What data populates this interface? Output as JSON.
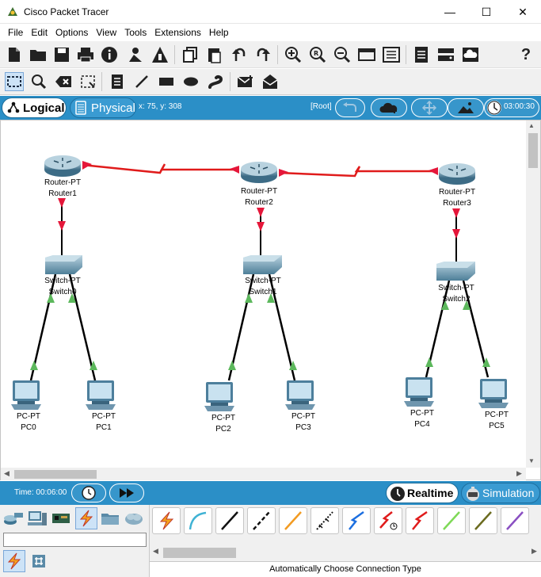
{
  "window": {
    "title": "Cisco Packet Tracer",
    "minimize": "—",
    "maximize": "☐",
    "close": "✕"
  },
  "menu": [
    {
      "label": "File"
    },
    {
      "label": "Edit"
    },
    {
      "label": "Options"
    },
    {
      "label": "View"
    },
    {
      "label": "Tools"
    },
    {
      "label": "Extensions"
    },
    {
      "label": "Help"
    }
  ],
  "toolbar_main": [
    "new-file-icon",
    "open-folder-icon",
    "save-icon",
    "print-icon",
    "info-icon",
    "activity-wizard-icon",
    "pdu-icon",
    "copy-icon",
    "paste-icon",
    "undo-icon",
    "redo-icon",
    "zoom-in-icon",
    "zoom-reset-icon",
    "zoom-out-icon",
    "palette-icon",
    "custom-device-icon",
    "notes-icon",
    "rack-icon",
    "cloud-icon",
    "help-icon"
  ],
  "mode": {
    "logical": "Logical",
    "physical": "Physical",
    "coords": "x: 75, y: 308",
    "root": "[Root]",
    "clock": "03:00:30"
  },
  "devices": {
    "routers": [
      {
        "type": "Router-PT",
        "name": "Router1"
      },
      {
        "type": "Router-PT",
        "name": "Router2"
      },
      {
        "type": "Router-PT",
        "name": "Router3"
      }
    ],
    "switches": [
      {
        "type": "Switch-PT",
        "name": "Switch0"
      },
      {
        "type": "Switch-PT",
        "name": "Switch1"
      },
      {
        "type": "Switch-PT",
        "name": "Switch2"
      }
    ],
    "pcs": [
      {
        "type": "PC-PT",
        "name": "PC0"
      },
      {
        "type": "PC-PT",
        "name": "PC1"
      },
      {
        "type": "PC-PT",
        "name": "PC2"
      },
      {
        "type": "PC-PT",
        "name": "PC3"
      },
      {
        "type": "PC-PT",
        "name": "PC4"
      },
      {
        "type": "PC-PT",
        "name": "PC5"
      }
    ]
  },
  "link_colors": {
    "serial": "#e01b1b",
    "ethernet": "#000000",
    "down_marker": "#e5173a",
    "up_marker": "#5cb85c"
  },
  "sim": {
    "time": "Time: 00:06:00",
    "realtime": "Realtime",
    "simulation": "Simulation"
  },
  "bottom": {
    "search_value": "",
    "status": "Automatically Choose Connection Type"
  },
  "connections": [
    "auto-connection-icon",
    "console-cable-icon",
    "copper-straight-icon",
    "copper-cross-icon",
    "fiber-icon",
    "phone-cable-icon",
    "coaxial-icon",
    "serial-dce-icon",
    "serial-dte-icon",
    "octal-cable-icon",
    "iot-custom-cable-icon",
    "usb-cable-icon"
  ]
}
